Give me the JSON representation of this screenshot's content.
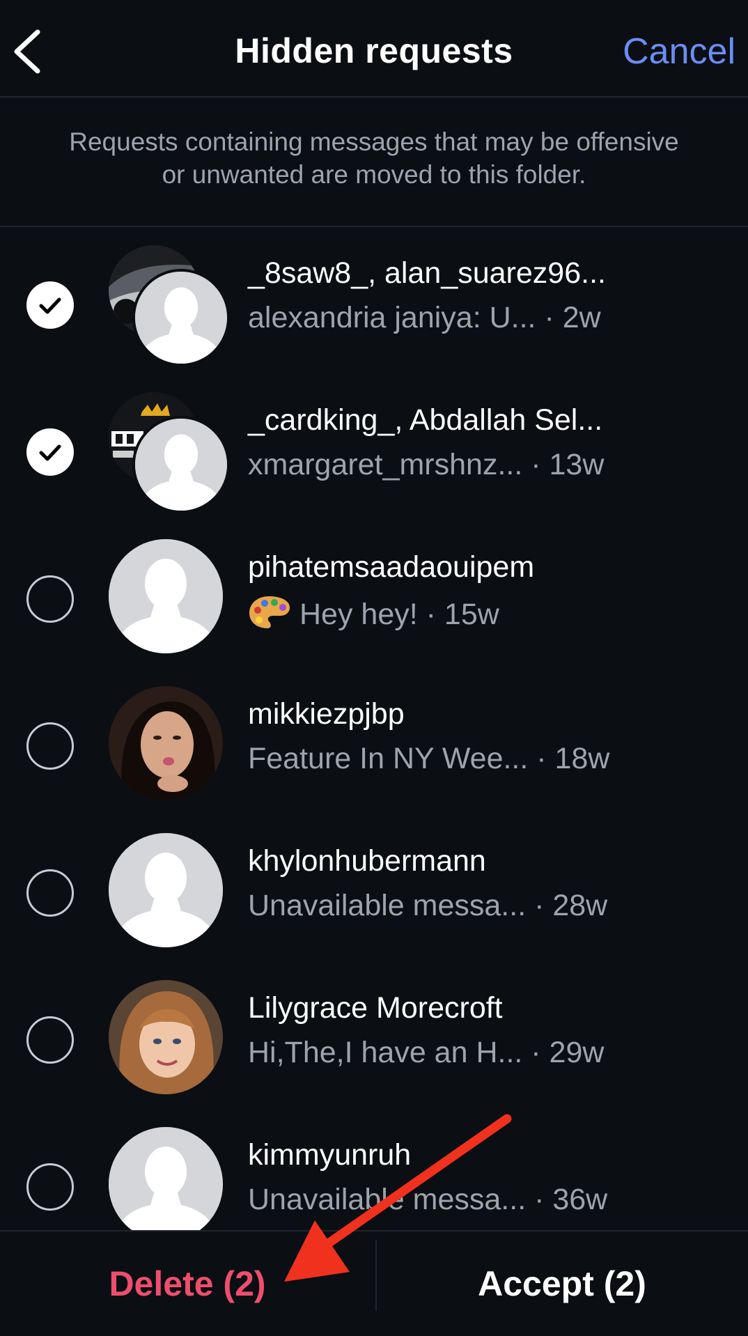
{
  "header": {
    "title": "Hidden requests",
    "cancel_label": "Cancel",
    "back_icon": "chevron-left-icon"
  },
  "info_text": "Requests containing messages that may be offensive or unwanted are moved to this folder.",
  "requests": [
    {
      "name": "_8saw8_, alan_suarez96...",
      "preview": "alexandria janiya: U...  · 2w",
      "selected": true,
      "avatar": "group-car"
    },
    {
      "name": "_cardking_, Abdallah Sel...",
      "preview": "xmargaret_mrshnz... · 13w",
      "selected": true,
      "avatar": "group-cardking"
    },
    {
      "name": "pihatemsaadaouipem",
      "preview": "Hey hey! · 15w",
      "preview_icon": "palette-emoji",
      "selected": false,
      "avatar": "default"
    },
    {
      "name": "mikkiezpjbp",
      "preview": "Feature In NY Wee...  · 18w",
      "selected": false,
      "avatar": "photo-woman"
    },
    {
      "name": "khylonhubermann",
      "preview": "Unavailable messa... · 28w",
      "selected": false,
      "avatar": "default"
    },
    {
      "name": "Lilygrace Morecroft",
      "preview": "Hi,The,I have an H...  · 29w",
      "selected": false,
      "avatar": "photo-girl"
    },
    {
      "name": "kimmyunruh",
      "preview": "Unavailable messa... · 36w",
      "selected": false,
      "avatar": "default"
    }
  ],
  "bottom": {
    "delete_label": "Delete (2)",
    "accept_label": "Accept (2)"
  },
  "colors": {
    "background": "#0b0e13",
    "accent_blue": "#6b8ef5",
    "delete_red": "#ee4e6e",
    "annotation_arrow": "#f0311d"
  }
}
